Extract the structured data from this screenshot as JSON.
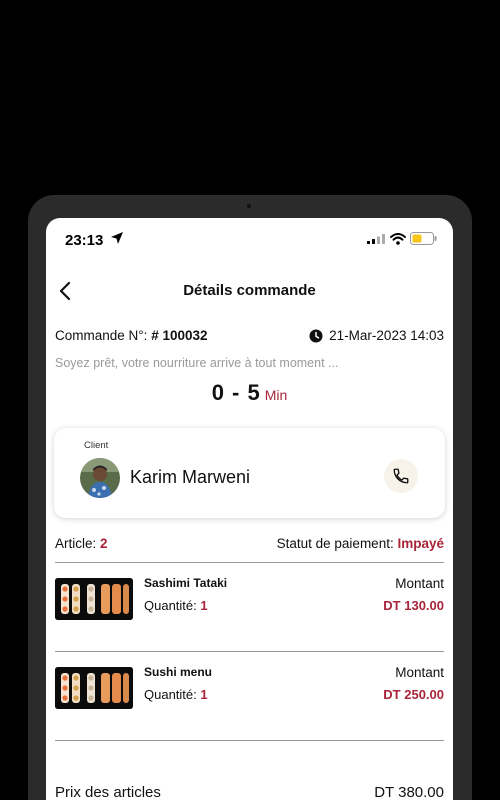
{
  "status_bar": {
    "time": "23:13",
    "icons": [
      "location-arrow-icon",
      "signal-icon",
      "wifi-icon",
      "battery-icon"
    ]
  },
  "header": {
    "title": "Détails commande",
    "back_icon": "chevron-left-icon"
  },
  "order": {
    "number_label": "Commande N°:",
    "number": "# 100032",
    "date": "21-Mar-2023 14:03",
    "message": "Soyez prêt, votre nourriture arrive à tout moment ...",
    "eta_range": "0 - 5",
    "eta_unit": "Min"
  },
  "client": {
    "label": "Client",
    "name": "Karim Marweni"
  },
  "summary": {
    "article_label": "Article:",
    "article_count": "2",
    "payment_label": "Statut de paiement:",
    "payment_status": "Impayé"
  },
  "items": [
    {
      "name": "Sashimi Tataki",
      "qty_label": "Quantité:",
      "qty": "1",
      "amount_label": "Montant",
      "price": "DT 130.00"
    },
    {
      "name": "Sushi menu",
      "qty_label": "Quantité:",
      "qty": "1",
      "amount_label": "Montant",
      "price": "DT 250.00"
    }
  ],
  "totals": {
    "items_label": "Prix des articles",
    "items_value": "DT 380.00"
  },
  "colors": {
    "accent": "#a8253a",
    "muted": "#9a9a9a",
    "battery": "#f5c518"
  }
}
